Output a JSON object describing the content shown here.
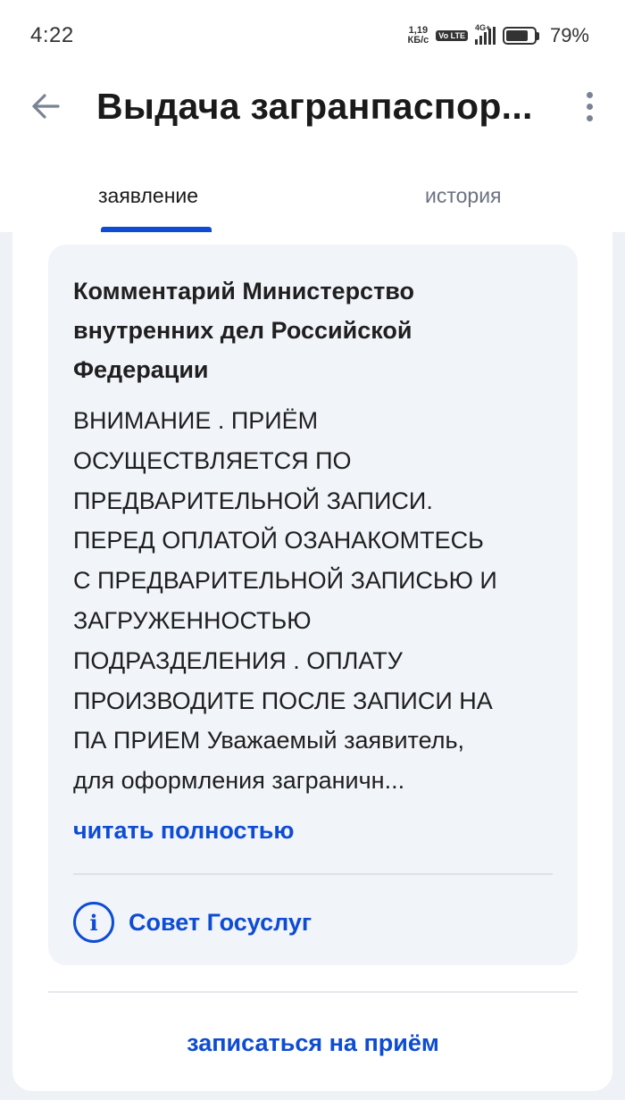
{
  "status_bar": {
    "time": "4:22",
    "net_speed_value": "1,19",
    "net_speed_unit": "КБ/с",
    "volte": "Vo LTE",
    "network": "4G+",
    "battery_percent": "79%",
    "battery_level": 0.79
  },
  "header": {
    "title": "Выдача загранпаспор...",
    "back_icon": "arrow-left-icon",
    "menu_icon": "more-vertical-icon"
  },
  "tabs": [
    {
      "label": "заявление",
      "active": true
    },
    {
      "label": "история",
      "active": false
    }
  ],
  "comment": {
    "title": "Комментарий Министерство внутренних дел Российской Федерации",
    "body_lines": [
      "ВНИМАНИЕ . ПРИЁМ",
      "ОСУЩЕСТВЛЯЕТСЯ ПО",
      "ПРЕДВАРИТЕЛЬНОЙ ЗАПИСИ.",
      "ПЕРЕД ОПЛАТОЙ ОЗАНАКОМТЕСЬ",
      "С ПРЕДВАРИТЕЛЬНОЙ ЗАПИСЬЮ И",
      "ЗАГРУЖЕННОСТЬЮ",
      "ПОДРАЗДЕЛЕНИЯ . ОПЛАТУ",
      "ПРОИЗВОДИТЕ ПОСЛЕ ЗАПИСИ НА",
      "ПА ПРИЕМ Уважаемый заявитель,",
      "для оформления заграничн..."
    ],
    "read_more": "читать полностью",
    "tip_icon": "info-icon",
    "tip_label": "Совет Госуслуг"
  },
  "actions": {
    "appointment": "записаться на приём"
  },
  "colors": {
    "accent": "#0d4cd3",
    "card_background": "#f1f4f9",
    "page_background": "#eef1f6"
  }
}
